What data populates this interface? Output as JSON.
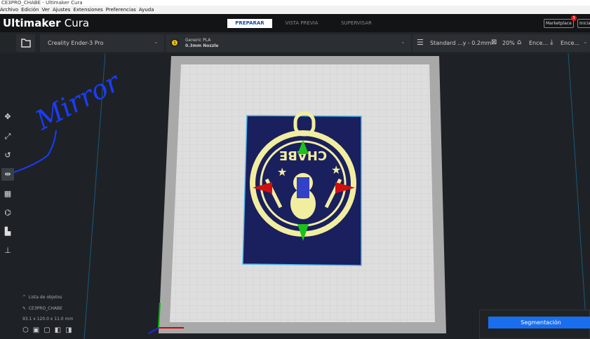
{
  "window": {
    "title": "CE3PRO_CHABE - Ultimaker Cura"
  },
  "menu": [
    "Archivo",
    "Edición",
    "Ver",
    "Ajustes",
    "Extensiones",
    "Preferencias",
    "Ayuda"
  ],
  "header": {
    "logo_bold": "Ultimaker",
    "logo_light": "Cura",
    "stages": [
      "PREPARAR",
      "VISTA PREVIA",
      "SUPERVISAR"
    ],
    "marketplace": "Marketplace",
    "marketplace_badge": "3",
    "signin": "Iniciar"
  },
  "toolbar": {
    "printer": "Creality Ender-3 Pro",
    "extruder_num": "1",
    "material": "Generic PLA",
    "nozzle": "0.3mm Nozzle",
    "profile": "Standard ...y - 0.2mm",
    "infill": "20%",
    "support": "Ence...",
    "adhesion": "Ence..."
  },
  "objects": {
    "header": "Lista de objetos",
    "name": "CE3PRO_CHABE",
    "dims": "93.1 x 120.0 x 11.0 mm"
  },
  "annotation": "Mirror",
  "slice_label": "Segmentación",
  "colors": {
    "accent": "#196ef0",
    "model": "#f2eea0",
    "annotation": "#1a3cff"
  }
}
